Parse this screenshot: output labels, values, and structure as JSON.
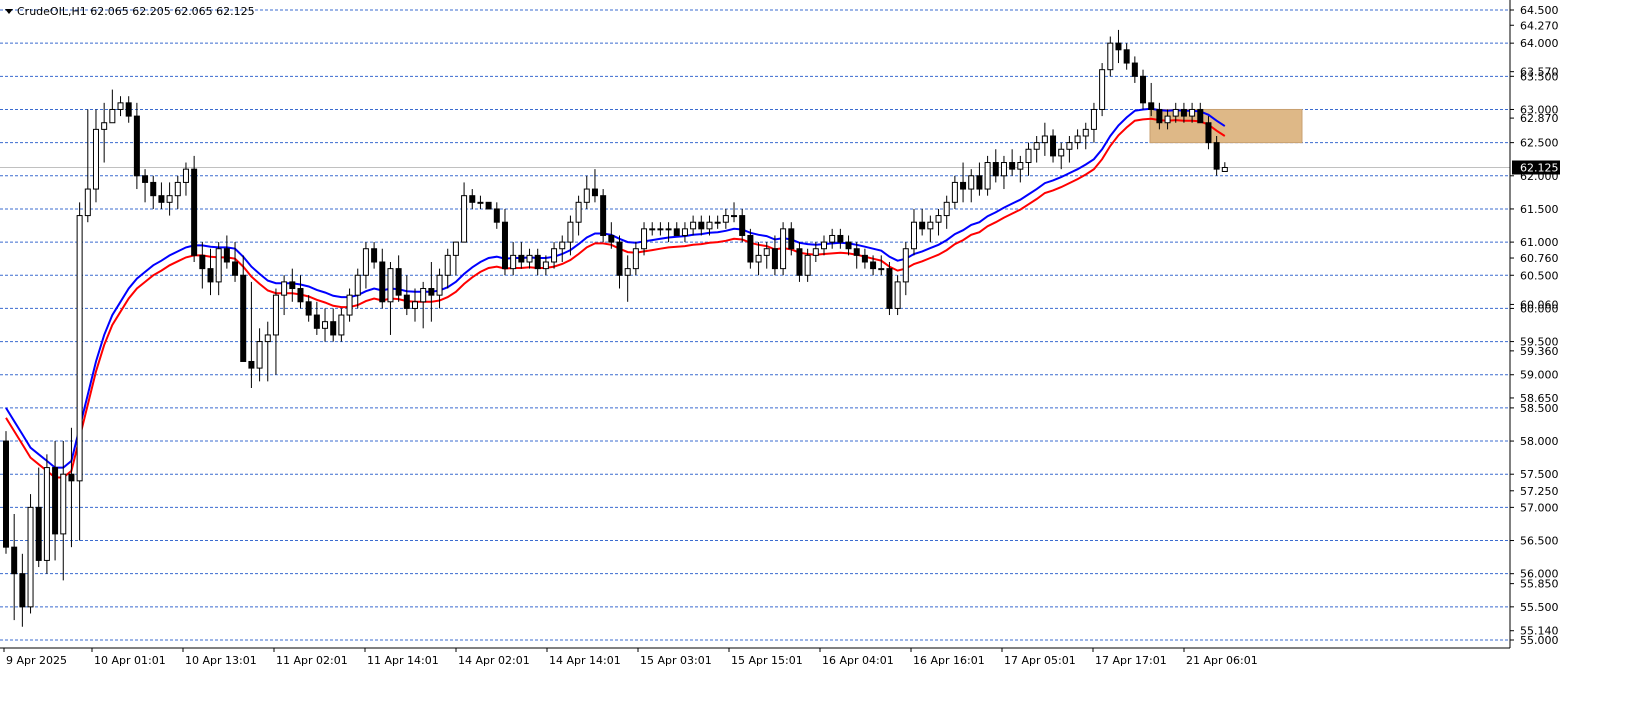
{
  "header": {
    "symbol_line": "CrudeOIL,H1  62.065 62.205 62.065 62.125"
  },
  "chart_data": {
    "type": "candlestick",
    "symbol": "CrudeOIL",
    "timeframe": "H1",
    "ohlc_current": [
      62.065,
      62.205,
      62.065,
      62.125
    ],
    "ylim": [
      55.0,
      64.5
    ],
    "grid": true,
    "grid_levels": [
      64.5,
      64.0,
      63.5,
      63.0,
      62.5,
      62.0,
      61.5,
      61.0,
      60.5,
      60.0,
      59.5,
      59.0,
      58.5,
      58.0,
      57.5,
      57.0,
      56.5,
      56.0,
      55.5,
      55.0
    ],
    "y_tick_labels": [
      "64.500",
      "64.270",
      "64.000",
      "63.570",
      "63.500",
      "63.000",
      "62.870",
      "62.500",
      "62.000",
      "61.500",
      "61.000",
      "60.760",
      "60.500",
      "60.060",
      "60.000",
      "59.500",
      "59.360",
      "59.000",
      "58.650",
      "58.500",
      "58.000",
      "57.500",
      "57.250",
      "57.000",
      "56.500",
      "56.000",
      "55.850",
      "55.500",
      "55.140",
      "55.000"
    ],
    "y_tick_values": [
      64.5,
      64.27,
      64.0,
      63.57,
      63.5,
      63.0,
      62.87,
      62.5,
      62.0,
      61.5,
      61.0,
      60.76,
      60.5,
      60.06,
      60.0,
      59.5,
      59.36,
      59.0,
      58.65,
      58.5,
      58.0,
      57.5,
      57.25,
      57.0,
      56.5,
      56.0,
      55.85,
      55.5,
      55.14,
      55.0
    ],
    "current_price_label": "62.125",
    "current_price": 62.125,
    "x_tick_labels": [
      "9 Apr 2025",
      "10 Apr 01:01",
      "10 Apr 13:01",
      "11 Apr 02:01",
      "11 Apr 14:01",
      "14 Apr 02:01",
      "14 Apr 14:01",
      "15 Apr 03:01",
      "15 Apr 15:01",
      "16 Apr 04:01",
      "16 Apr 16:01",
      "17 Apr 05:01",
      "17 Apr 17:01",
      "21 Apr 06:01"
    ],
    "colors": {
      "bull_body": "#ffffff",
      "bear_body": "#000000",
      "wick": "#000000",
      "ma_fast": "#0000ff",
      "ma_slow": "#ff0000",
      "grid": "#3b6bcf",
      "zone": "#deb887",
      "price_label_bg": "#000000"
    },
    "zone": {
      "from_price": 62.5,
      "to_price": 63.0
    },
    "candles": [
      [
        58.0,
        58.15,
        56.3,
        56.4
      ],
      [
        56.4,
        56.9,
        55.3,
        56.0
      ],
      [
        56.0,
        56.3,
        55.2,
        55.5
      ],
      [
        55.5,
        57.2,
        55.4,
        57.0
      ],
      [
        57.0,
        57.6,
        56.1,
        56.2
      ],
      [
        56.2,
        57.8,
        56.0,
        57.6
      ],
      [
        57.6,
        58.0,
        56.2,
        56.6
      ],
      [
        56.6,
        58.0,
        55.9,
        57.5
      ],
      [
        57.5,
        58.2,
        56.4,
        57.4
      ],
      [
        57.4,
        61.6,
        56.5,
        61.4
      ],
      [
        61.4,
        63.0,
        61.3,
        61.8
      ],
      [
        61.8,
        63.0,
        61.6,
        62.7
      ],
      [
        62.7,
        63.1,
        62.2,
        62.8
      ],
      [
        62.8,
        63.3,
        62.8,
        63.0
      ],
      [
        63.0,
        63.2,
        62.9,
        63.1
      ],
      [
        63.1,
        63.2,
        62.8,
        62.9
      ],
      [
        62.9,
        63.1,
        61.8,
        62.0
      ],
      [
        62.0,
        62.1,
        61.6,
        61.9
      ],
      [
        61.9,
        62.0,
        61.5,
        61.7
      ],
      [
        61.7,
        61.9,
        61.5,
        61.6
      ],
      [
        61.6,
        61.9,
        61.4,
        61.7
      ],
      [
        61.7,
        62.0,
        61.5,
        61.9
      ],
      [
        61.9,
        62.2,
        61.7,
        62.1
      ],
      [
        62.1,
        62.3,
        60.7,
        60.8
      ],
      [
        60.8,
        61.0,
        60.3,
        60.6
      ],
      [
        60.6,
        60.9,
        60.2,
        60.4
      ],
      [
        60.4,
        61.0,
        60.2,
        60.9
      ],
      [
        60.9,
        61.1,
        60.6,
        60.7
      ],
      [
        60.7,
        61.0,
        60.4,
        60.5
      ],
      [
        60.5,
        60.8,
        59.3,
        59.2
      ],
      [
        59.2,
        60.4,
        58.8,
        59.1
      ],
      [
        59.1,
        59.7,
        58.9,
        59.5
      ],
      [
        59.5,
        59.8,
        58.9,
        59.6
      ],
      [
        59.6,
        60.3,
        59.0,
        60.2
      ],
      [
        60.2,
        60.5,
        59.9,
        60.4
      ],
      [
        60.4,
        60.6,
        60.1,
        60.3
      ],
      [
        60.3,
        60.5,
        60.0,
        60.1
      ],
      [
        60.1,
        60.2,
        59.8,
        59.9
      ],
      [
        59.9,
        60.1,
        59.6,
        59.7
      ],
      [
        59.7,
        60.0,
        59.5,
        59.8
      ],
      [
        59.8,
        60.0,
        59.5,
        59.6
      ],
      [
        59.6,
        60.0,
        59.5,
        59.9
      ],
      [
        59.9,
        60.3,
        59.8,
        60.2
      ],
      [
        60.2,
        60.6,
        60.0,
        60.5
      ],
      [
        60.5,
        61.0,
        60.3,
        60.9
      ],
      [
        60.9,
        61.0,
        60.6,
        60.7
      ],
      [
        60.7,
        60.9,
        60.0,
        60.1
      ],
      [
        60.1,
        60.7,
        59.6,
        60.6
      ],
      [
        60.6,
        60.8,
        60.1,
        60.2
      ],
      [
        60.2,
        60.5,
        59.9,
        60.0
      ],
      [
        60.0,
        60.3,
        59.8,
        60.1
      ],
      [
        60.1,
        60.4,
        59.7,
        60.3
      ],
      [
        60.3,
        60.7,
        59.8,
        60.2
      ],
      [
        60.2,
        60.6,
        60.0,
        60.5
      ],
      [
        60.5,
        60.9,
        60.3,
        60.8
      ],
      [
        60.8,
        61.0,
        60.5,
        61.0
      ],
      [
        61.0,
        61.9,
        61.0,
        61.7
      ],
      [
        61.7,
        61.8,
        61.5,
        61.6
      ],
      [
        61.6,
        61.7,
        61.5,
        61.6
      ],
      [
        61.6,
        61.6,
        61.5,
        61.5
      ],
      [
        61.5,
        61.6,
        61.2,
        61.3
      ],
      [
        61.3,
        61.5,
        60.5,
        60.6
      ],
      [
        60.6,
        61.0,
        60.5,
        60.8
      ],
      [
        60.8,
        61.0,
        60.6,
        60.7
      ],
      [
        60.7,
        60.9,
        60.6,
        60.8
      ],
      [
        60.8,
        60.9,
        60.5,
        60.6
      ],
      [
        60.6,
        60.8,
        60.5,
        60.7
      ],
      [
        60.7,
        61.0,
        60.6,
        60.9
      ],
      [
        60.9,
        61.1,
        60.7,
        61.0
      ],
      [
        61.0,
        61.4,
        60.8,
        61.3
      ],
      [
        61.3,
        61.7,
        61.1,
        61.6
      ],
      [
        61.6,
        62.0,
        61.5,
        61.8
      ],
      [
        61.8,
        62.1,
        61.6,
        61.7
      ],
      [
        61.7,
        61.8,
        61.0,
        61.1
      ],
      [
        61.1,
        61.3,
        60.9,
        61.0
      ],
      [
        61.0,
        61.1,
        60.3,
        60.5
      ],
      [
        60.5,
        60.8,
        60.1,
        60.6
      ],
      [
        60.6,
        61.0,
        60.5,
        60.9
      ],
      [
        60.9,
        61.3,
        60.8,
        61.2
      ],
      [
        61.2,
        61.3,
        61.1,
        61.2
      ],
      [
        61.2,
        61.3,
        61.1,
        61.2
      ],
      [
        61.2,
        61.3,
        61.0,
        61.2
      ],
      [
        61.2,
        61.3,
        61.1,
        61.1
      ],
      [
        61.1,
        61.3,
        61.0,
        61.2
      ],
      [
        61.2,
        61.4,
        61.1,
        61.3
      ],
      [
        61.3,
        61.4,
        61.1,
        61.2
      ],
      [
        61.2,
        61.4,
        61.1,
        61.3
      ],
      [
        61.3,
        61.4,
        61.2,
        61.3
      ],
      [
        61.3,
        61.5,
        61.2,
        61.4
      ],
      [
        61.4,
        61.6,
        61.3,
        61.4
      ],
      [
        61.4,
        61.5,
        61.0,
        61.1
      ],
      [
        61.1,
        61.2,
        60.6,
        60.7
      ],
      [
        60.7,
        61.0,
        60.5,
        60.8
      ],
      [
        60.8,
        61.0,
        60.6,
        60.9
      ],
      [
        60.9,
        61.1,
        60.5,
        60.6
      ],
      [
        60.6,
        61.3,
        60.5,
        61.2
      ],
      [
        61.2,
        61.3,
        60.8,
        60.9
      ],
      [
        60.9,
        61.0,
        60.4,
        60.5
      ],
      [
        60.5,
        60.9,
        60.4,
        60.8
      ],
      [
        60.8,
        61.0,
        60.7,
        60.9
      ],
      [
        60.9,
        61.1,
        60.8,
        61.0
      ],
      [
        61.0,
        61.2,
        60.9,
        61.1
      ],
      [
        61.1,
        61.2,
        60.9,
        61.0
      ],
      [
        61.0,
        61.1,
        60.8,
        60.9
      ],
      [
        60.9,
        61.0,
        60.6,
        60.8
      ],
      [
        60.8,
        60.9,
        60.6,
        60.7
      ],
      [
        60.7,
        60.8,
        60.5,
        60.6
      ],
      [
        60.6,
        60.8,
        60.5,
        60.6
      ],
      [
        60.6,
        60.7,
        59.9,
        60.0
      ],
      [
        60.0,
        60.5,
        59.9,
        60.4
      ],
      [
        60.4,
        61.0,
        60.2,
        60.9
      ],
      [
        60.9,
        61.5,
        60.8,
        61.3
      ],
      [
        61.3,
        61.5,
        61.1,
        61.2
      ],
      [
        61.2,
        61.4,
        61.0,
        61.3
      ],
      [
        61.3,
        61.5,
        61.1,
        61.4
      ],
      [
        61.4,
        61.7,
        61.2,
        61.6
      ],
      [
        61.6,
        62.0,
        61.5,
        61.9
      ],
      [
        61.9,
        62.2,
        61.6,
        61.8
      ],
      [
        61.8,
        62.1,
        61.6,
        62.0
      ],
      [
        62.0,
        62.2,
        61.7,
        61.8
      ],
      [
        61.8,
        62.3,
        61.7,
        62.2
      ],
      [
        62.2,
        62.4,
        61.9,
        62.0
      ],
      [
        62.0,
        62.3,
        61.8,
        62.2
      ],
      [
        62.2,
        62.4,
        62.0,
        62.1
      ],
      [
        62.1,
        62.3,
        61.9,
        62.2
      ],
      [
        62.2,
        62.5,
        62.0,
        62.4
      ],
      [
        62.4,
        62.6,
        62.2,
        62.5
      ],
      [
        62.5,
        62.8,
        62.3,
        62.6
      ],
      [
        62.6,
        62.7,
        62.2,
        62.3
      ],
      [
        62.3,
        62.5,
        62.1,
        62.4
      ],
      [
        62.4,
        62.6,
        62.2,
        62.5
      ],
      [
        62.5,
        62.7,
        62.4,
        62.6
      ],
      [
        62.6,
        62.8,
        62.4,
        62.7
      ],
      [
        62.7,
        63.1,
        62.5,
        63.0
      ],
      [
        63.0,
        63.7,
        62.9,
        63.6
      ],
      [
        63.6,
        64.1,
        63.5,
        64.0
      ],
      [
        64.0,
        64.2,
        63.7,
        63.9
      ],
      [
        63.9,
        64.0,
        63.6,
        63.7
      ],
      [
        63.7,
        63.8,
        63.4,
        63.5
      ],
      [
        63.5,
        63.6,
        63.0,
        63.1
      ],
      [
        63.1,
        63.4,
        62.9,
        63.0
      ],
      [
        63.0,
        63.1,
        62.7,
        62.8
      ],
      [
        62.8,
        63.0,
        62.7,
        62.9
      ],
      [
        62.9,
        63.1,
        62.8,
        63.0
      ],
      [
        63.0,
        63.1,
        62.8,
        62.9
      ],
      [
        62.9,
        63.1,
        62.8,
        63.0
      ],
      [
        63.0,
        63.1,
        62.8,
        62.8
      ],
      [
        62.8,
        62.9,
        62.4,
        62.5
      ],
      [
        62.5,
        62.6,
        62.0,
        62.1
      ],
      [
        62.065,
        62.205,
        62.065,
        62.125
      ]
    ],
    "ma_fast_values": [
      58.5,
      58.3,
      58.1,
      57.9,
      57.8,
      57.7,
      57.6,
      57.6,
      57.7,
      58.2,
      58.7,
      59.2,
      59.6,
      59.9,
      60.1,
      60.3,
      60.45,
      60.55,
      60.65,
      60.72,
      60.8,
      60.86,
      60.92,
      60.95,
      60.95,
      60.93,
      60.92,
      60.92,
      60.9,
      60.78,
      60.63,
      60.52,
      60.42,
      60.38,
      60.38,
      60.38,
      60.36,
      60.33,
      60.28,
      60.24,
      60.19,
      60.17,
      60.17,
      60.2,
      60.26,
      60.3,
      60.27,
      60.3,
      60.29,
      60.26,
      60.25,
      60.25,
      60.25,
      60.27,
      60.32,
      60.4,
      60.52,
      60.62,
      60.7,
      60.76,
      60.78,
      60.75,
      60.76,
      60.76,
      60.77,
      60.76,
      60.76,
      60.78,
      60.82,
      60.88,
      60.97,
      61.07,
      61.13,
      61.13,
      61.11,
      61.05,
      61.0,
      60.99,
      61.01,
      61.03,
      61.05,
      61.07,
      61.08,
      61.09,
      61.11,
      61.12,
      61.14,
      61.15,
      61.17,
      61.2,
      61.19,
      61.14,
      61.11,
      61.09,
      61.04,
      61.06,
      61.04,
      60.99,
      60.97,
      60.96,
      60.97,
      60.98,
      60.99,
      60.98,
      60.96,
      60.93,
      60.9,
      60.87,
      60.78,
      60.72,
      60.75,
      60.82,
      60.86,
      60.91,
      60.96,
      61.03,
      61.12,
      61.18,
      61.26,
      61.3,
      61.39,
      61.45,
      61.52,
      61.58,
      61.64,
      61.72,
      61.8,
      61.89,
      61.93,
      61.98,
      62.04,
      62.1,
      62.17,
      62.25,
      62.4,
      62.6,
      62.76,
      62.88,
      62.98,
      63.0,
      63.01,
      62.99,
      62.98,
      62.99,
      62.98,
      62.98,
      62.97,
      62.92,
      62.83,
      62.75
    ]
  }
}
